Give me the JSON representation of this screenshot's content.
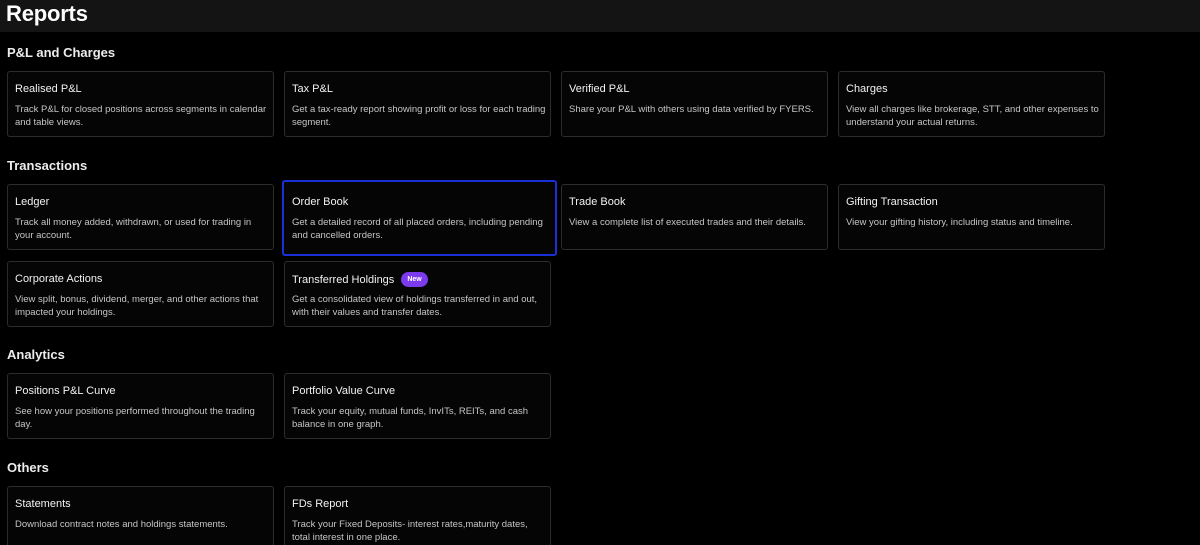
{
  "page": {
    "title": "Reports"
  },
  "colors": {
    "accent_selected": "#1a2fd6",
    "badge_new": "#7c3aed",
    "background": "#000000"
  },
  "sections": [
    {
      "title": "P&L and Charges",
      "cards": [
        {
          "title": "Realised P&L",
          "description": "Track P&L for closed positions across segments in calendar and table views."
        },
        {
          "title": "Tax P&L",
          "description": "Get a tax-ready report showing profit or loss for each trading segment."
        },
        {
          "title": "Verified P&L",
          "description": "Share your P&L with others using data verified by FYERS."
        },
        {
          "title": "Charges",
          "description": "View all charges like brokerage, STT, and other expenses to understand your actual returns."
        }
      ]
    },
    {
      "title": "Transactions",
      "cards": [
        {
          "title": "Ledger",
          "description": "Track all money added, withdrawn, or used for trading in your account."
        },
        {
          "title": "Order Book",
          "description": "Get a detailed record of all placed orders, including pending and cancelled orders.",
          "selected": true
        },
        {
          "title": "Trade Book",
          "description": "View a complete list of executed trades and their details."
        },
        {
          "title": "Gifting Transaction",
          "description": "View your gifting history, including status and timeline."
        },
        {
          "title": "Corporate Actions",
          "description": "View split, bonus, dividend, merger, and other actions that impacted your holdings."
        },
        {
          "title": "Transferred Holdings",
          "badge": "New",
          "description": "Get a consolidated view of holdings transferred in and out, with their values and transfer dates."
        }
      ]
    },
    {
      "title": "Analytics",
      "cards": [
        {
          "title": "Positions P&L Curve",
          "description": "See how your positions performed throughout the trading day."
        },
        {
          "title": "Portfolio Value Curve",
          "description": "Track your equity, mutual funds, InvITs, REITs, and cash balance in one graph."
        }
      ]
    },
    {
      "title": "Others",
      "cards": [
        {
          "title": "Statements",
          "description": "Download contract notes and holdings statements."
        },
        {
          "title": "FDs Report",
          "description": "Track your Fixed Deposits- interest rates,maturity dates, total interest in one place."
        }
      ]
    }
  ]
}
